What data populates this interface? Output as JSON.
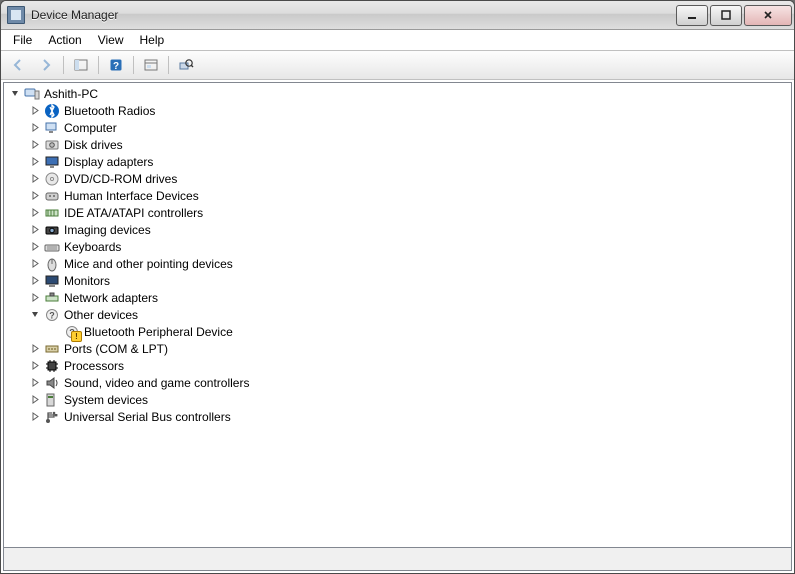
{
  "window": {
    "title": "Device Manager"
  },
  "menu": {
    "items": [
      "File",
      "Action",
      "View",
      "Help"
    ]
  },
  "toolbar": {
    "back": {
      "name": "back-button",
      "enabled": false
    },
    "forward": {
      "name": "forward-button",
      "enabled": false
    },
    "show_hide": {
      "name": "show-hide-console-tree-button",
      "enabled": true
    },
    "help": {
      "name": "help-button",
      "enabled": true
    },
    "properties": {
      "name": "properties-button",
      "enabled": true
    },
    "scan": {
      "name": "scan-hardware-button",
      "enabled": true
    }
  },
  "tree": {
    "root": {
      "label": "Ashith-PC",
      "icon": "computer-root",
      "expanded": true
    },
    "categories": [
      {
        "label": "Bluetooth Radios",
        "icon": "bluetooth",
        "expanded": false,
        "hasChildren": true
      },
      {
        "label": "Computer",
        "icon": "computer",
        "expanded": false,
        "hasChildren": true
      },
      {
        "label": "Disk drives",
        "icon": "disk",
        "expanded": false,
        "hasChildren": true
      },
      {
        "label": "Display adapters",
        "icon": "display",
        "expanded": false,
        "hasChildren": true
      },
      {
        "label": "DVD/CD-ROM drives",
        "icon": "dvd",
        "expanded": false,
        "hasChildren": true
      },
      {
        "label": "Human Interface Devices",
        "icon": "hid",
        "expanded": false,
        "hasChildren": true
      },
      {
        "label": "IDE ATA/ATAPI controllers",
        "icon": "ide",
        "expanded": false,
        "hasChildren": true
      },
      {
        "label": "Imaging devices",
        "icon": "imaging",
        "expanded": false,
        "hasChildren": true
      },
      {
        "label": "Keyboards",
        "icon": "keyboard",
        "expanded": false,
        "hasChildren": true
      },
      {
        "label": "Mice and other pointing devices",
        "icon": "mouse",
        "expanded": false,
        "hasChildren": true
      },
      {
        "label": "Monitors",
        "icon": "monitor",
        "expanded": false,
        "hasChildren": true
      },
      {
        "label": "Network adapters",
        "icon": "network",
        "expanded": false,
        "hasChildren": true
      },
      {
        "label": "Other devices",
        "icon": "other",
        "expanded": true,
        "hasChildren": true,
        "children": [
          {
            "label": "Bluetooth Peripheral Device",
            "icon": "other",
            "warning": true
          }
        ]
      },
      {
        "label": "Ports (COM & LPT)",
        "icon": "port",
        "expanded": false,
        "hasChildren": true
      },
      {
        "label": "Processors",
        "icon": "cpu",
        "expanded": false,
        "hasChildren": true
      },
      {
        "label": "Sound, video and game controllers",
        "icon": "sound",
        "expanded": false,
        "hasChildren": true
      },
      {
        "label": "System devices",
        "icon": "system",
        "expanded": false,
        "hasChildren": true
      },
      {
        "label": "Universal Serial Bus controllers",
        "icon": "usb",
        "expanded": false,
        "hasChildren": true
      }
    ]
  }
}
